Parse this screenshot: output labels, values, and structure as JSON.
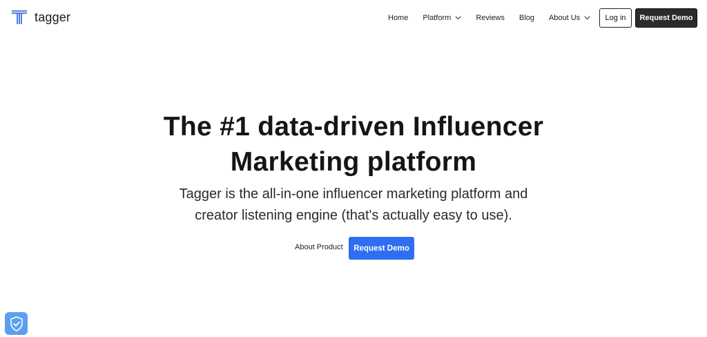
{
  "brand": {
    "name": "tagger",
    "logo_icon": "tagger-t-logo-icon",
    "accent_color": "#3b6fd8"
  },
  "nav": {
    "items": [
      {
        "label": "Home",
        "has_dropdown": false
      },
      {
        "label": "Platform",
        "has_dropdown": true
      },
      {
        "label": "Reviews",
        "has_dropdown": false
      },
      {
        "label": "Blog",
        "has_dropdown": false
      },
      {
        "label": "About Us",
        "has_dropdown": true
      }
    ],
    "login_label": "Log in",
    "request_demo_label": "Request Demo"
  },
  "hero": {
    "title_line1": "The #1 data-driven Influencer",
    "title_line2": "Marketing platform",
    "subtitle_line1": "Tagger is the all-in-one influencer marketing platform and",
    "subtitle_line2": "creator listening engine (that's actually easy to use).",
    "about_label": "About Product",
    "cta_label": "Request Demo",
    "cta_color": "#2f6df2"
  },
  "floating": {
    "icon": "shield-check-icon",
    "color": "#5b9ff0"
  }
}
